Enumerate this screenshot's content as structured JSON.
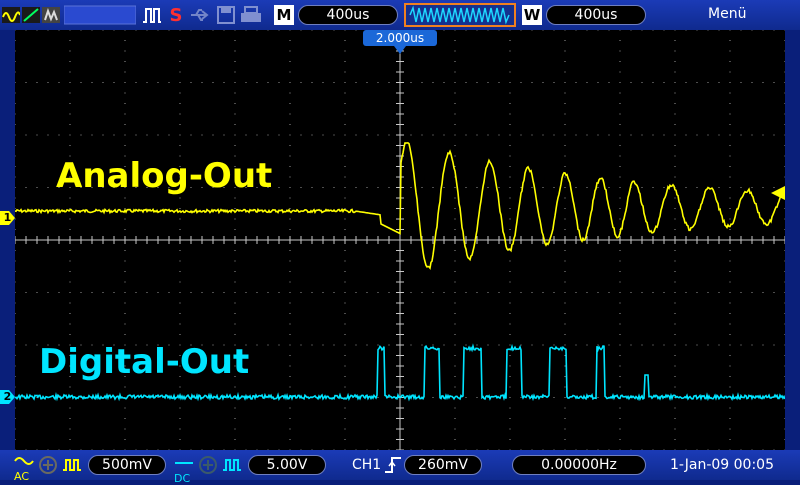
{
  "toolbar": {
    "timebase_label": "M",
    "timebase_value": "400us",
    "window_label": "W",
    "window_value": "400us",
    "menu_label": "Menü"
  },
  "screen": {
    "trigger_offset": "2.000us",
    "ch1_label": "Analog-Out",
    "ch2_label": "Digital-Out",
    "ch1_marker": "1",
    "ch2_marker": "2"
  },
  "bottom": {
    "ch1_coupling": "AC",
    "ch1_scale": "500mV",
    "ch2_coupling": "DC",
    "ch2_scale": "5.00V",
    "trigger_source": "CH1",
    "trigger_level": "260mV",
    "frequency": "0.00000Hz",
    "datetime": "1-Jan-09 00:05"
  },
  "colors": {
    "ch1": "#ffff00",
    "ch2": "#00e5ff",
    "accent": "#f08020",
    "background": "#0a1f7a"
  }
}
